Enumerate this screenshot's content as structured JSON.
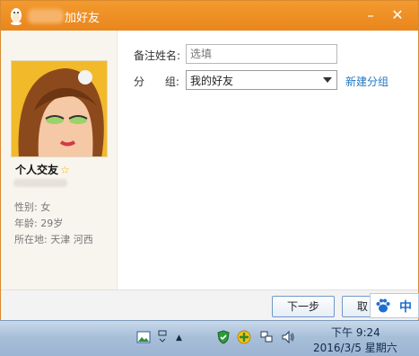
{
  "window": {
    "title": "加好友",
    "minimize_label": "–",
    "close_label": "✕"
  },
  "profile": {
    "nickname": "个人交友",
    "gender_label": "性别:",
    "gender_value": "女",
    "age_label": "年龄:",
    "age_value": "29岁",
    "location_label": "所在地:",
    "location_value": "天津  河西"
  },
  "form": {
    "remark_label": "备注姓名:",
    "remark_placeholder": "选填",
    "group_label": "分      组:",
    "group_value": "我的好友",
    "new_group_link": "新建分组"
  },
  "buttons": {
    "next": "下一步",
    "cancel": "取"
  },
  "ime": {
    "mode": "中"
  },
  "taskbar": {
    "time": "下午 9:24",
    "date": "2016/3/5 星期六",
    "overflow_arrow": "▲"
  },
  "colors": {
    "title_bar": "#ef9027",
    "link": "#2277c4",
    "taskbar": "#a8bfd9"
  }
}
